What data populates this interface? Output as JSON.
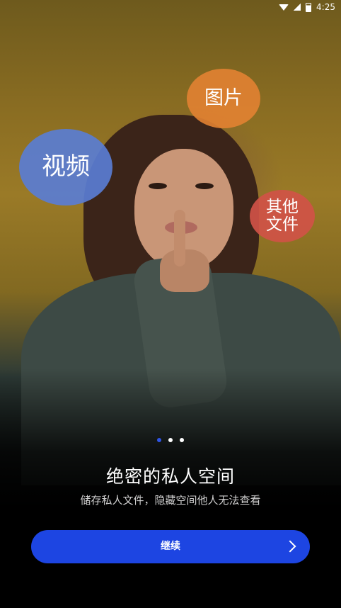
{
  "status_bar": {
    "time": "4:25"
  },
  "bubbles": {
    "video": "视频",
    "image": "图片",
    "other": "其他\n文件"
  },
  "pager": {
    "count": 3,
    "active": 1
  },
  "headline": "绝密的私人空间",
  "subtitle": "储存私人文件，隐藏空间他人无法查看",
  "continue_button": {
    "label": "继续",
    "icon": "chevron-right-icon"
  },
  "colors": {
    "accent": "#1d45e2",
    "bubble_video": "#5a7dd2",
    "bubble_image": "#e28232",
    "bubble_other": "#d05246",
    "pager_active": "#2f55e5"
  }
}
